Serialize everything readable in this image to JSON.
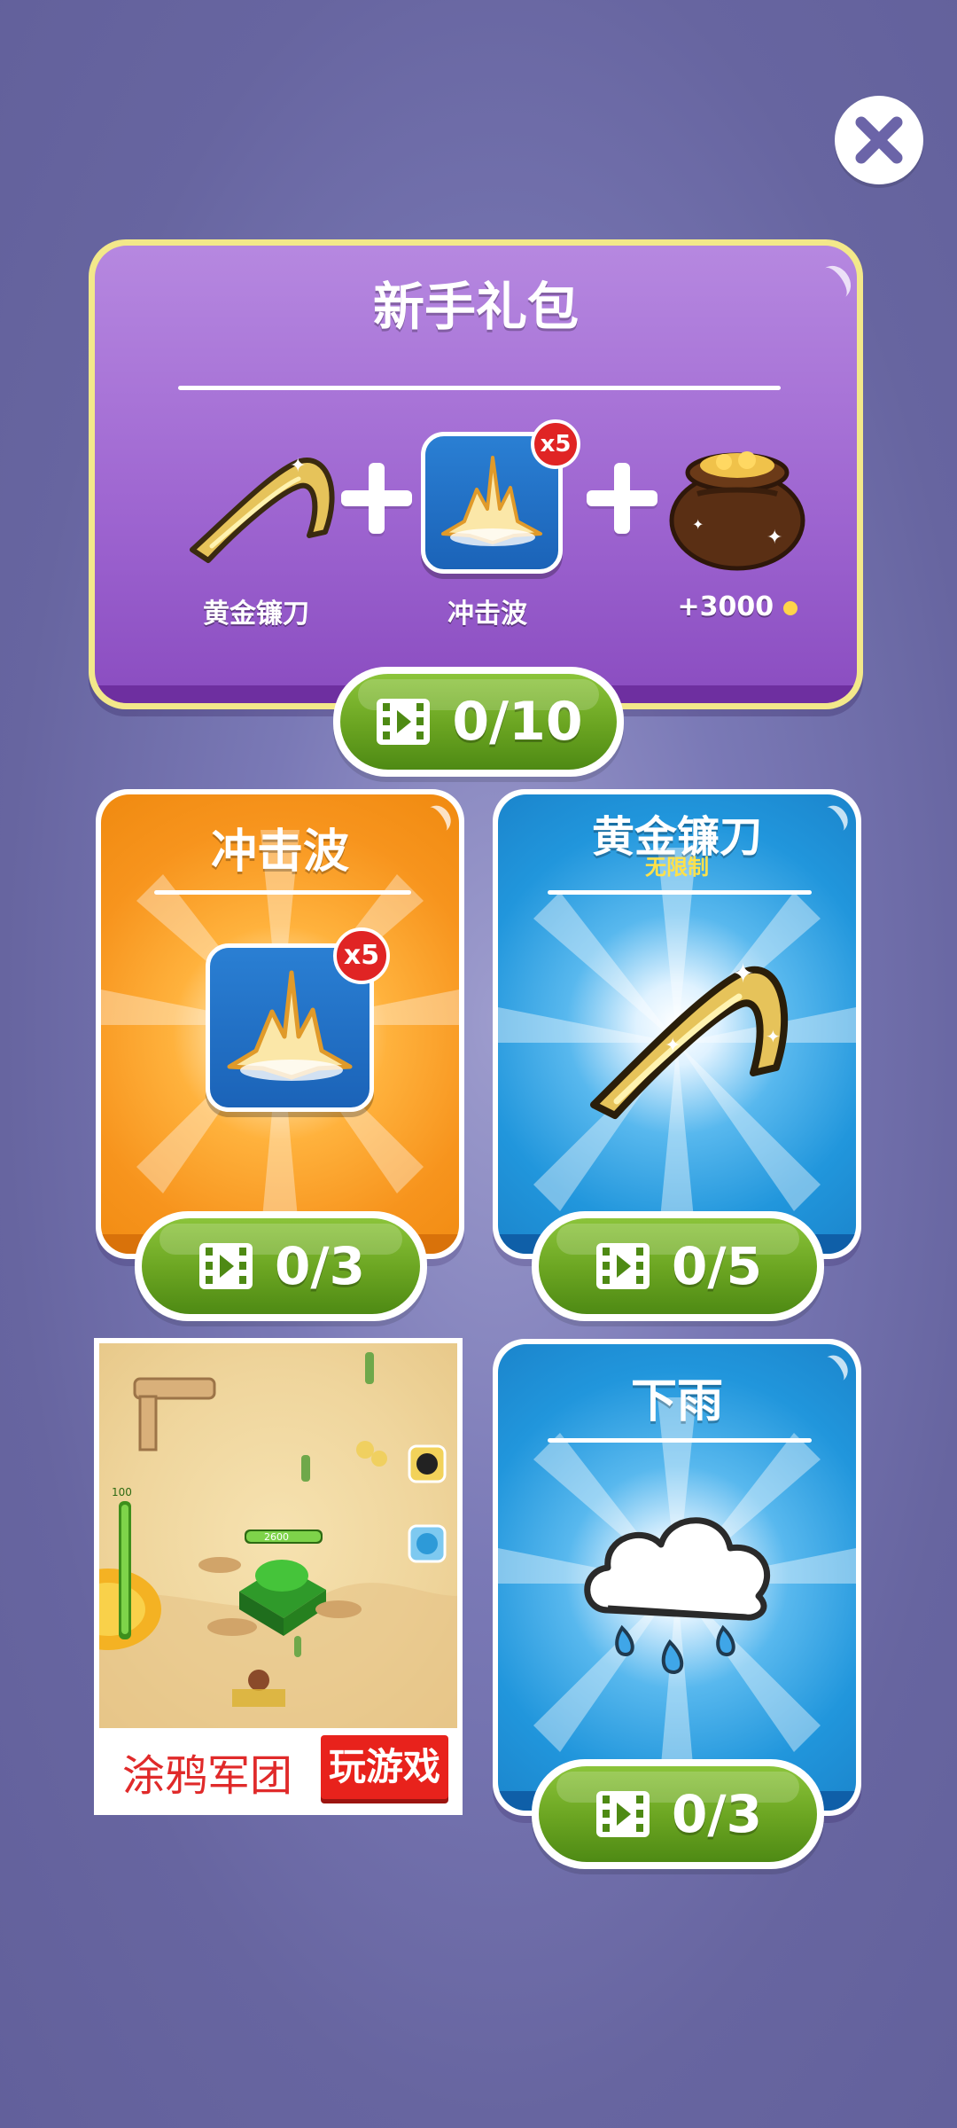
{
  "close": {
    "icon": "close-icon"
  },
  "starter_pack": {
    "title": "新手礼包",
    "items": [
      {
        "label": "黄金镰刀",
        "icon": "golden-sickle-icon"
      },
      {
        "label": "冲击波",
        "icon": "shockwave-icon",
        "badge": "x5"
      },
      {
        "label": "+3000",
        "icon": "gold-bag-icon",
        "suffix_icon": "coin-icon"
      }
    ],
    "progress": "0/10"
  },
  "cards": {
    "shockwave": {
      "title": "冲击波",
      "badge": "x5",
      "progress": "0/3"
    },
    "golden_sickle": {
      "title": "黄金镰刀",
      "subtitle": "无限制",
      "progress": "0/5"
    },
    "rain": {
      "title": "下雨",
      "progress": "0/3"
    }
  },
  "ad": {
    "game_name": "涂鸦军团",
    "play_label": "玩游戏",
    "hud_level": "100",
    "base_hp": "2600"
  },
  "colors": {
    "background": "#6765a0",
    "purple_panel": "#9d64d0",
    "orange_card": "#f7941d",
    "blue_card": "#2196dc",
    "green_button": "#6aa421",
    "badge_red": "#e02424"
  }
}
